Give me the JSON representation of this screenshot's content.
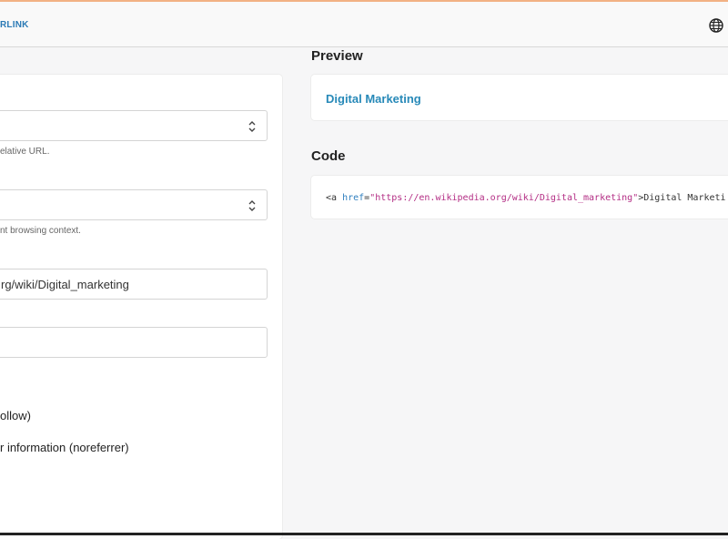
{
  "header": {
    "brand": "RLINK",
    "globe_icon": "globe-icon"
  },
  "form": {
    "select1": {
      "value": "",
      "help": "elative URL."
    },
    "select2": {
      "value": "",
      "help": "nt browsing context."
    },
    "url": {
      "value": "rg/wiki/Digital_marketing"
    },
    "text": {
      "value": ""
    },
    "option1": "ollow)",
    "option2": "r information (noreferrer)"
  },
  "preview": {
    "title": "Preview",
    "link_text": "Digital Marketing"
  },
  "code": {
    "title": "Code",
    "open": "<a",
    "attr": "href",
    "eq": "=",
    "value": "\"https://en.wikipedia.org/wiki/Digital_marketing\"",
    "rest": ">Digital Marketi"
  }
}
